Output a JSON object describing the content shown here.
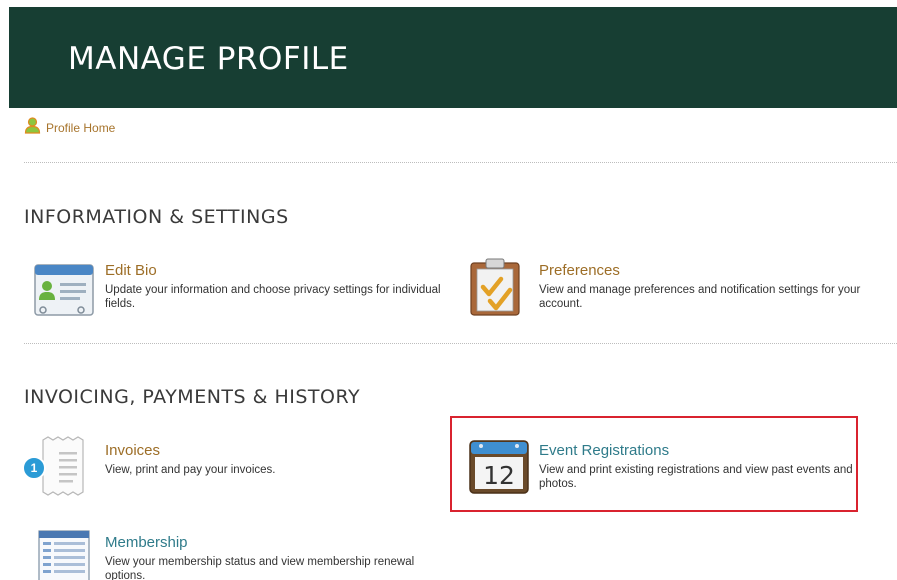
{
  "header": {
    "title": "MANAGE PROFILE"
  },
  "breadcrumb": {
    "label": "Profile Home",
    "icon": "user-icon"
  },
  "sections": [
    {
      "heading": "INFORMATION & SETTINGS",
      "items": [
        {
          "title": "Edit Bio",
          "description": "Update your information and choose privacy settings for individual fields.",
          "icon": "bio-card-icon"
        },
        {
          "title": "Preferences",
          "description": "View and manage preferences and notification settings for your account.",
          "icon": "clipboard-check-icon"
        }
      ]
    },
    {
      "heading": "INVOICING, PAYMENTS & HISTORY",
      "items": [
        {
          "title": "Invoices",
          "description": "View, print and pay your invoices.",
          "icon": "receipt-icon",
          "badge": "1"
        },
        {
          "title": "Event Registrations",
          "description": "View and print existing registrations and view past events and photos.",
          "icon": "calendar-icon",
          "icon_text": "12"
        },
        {
          "title": "Membership",
          "description": "View your membership status and view membership renewal options.",
          "icon": "membership-list-icon"
        }
      ]
    }
  ],
  "colors": {
    "header_bg": "#173e33",
    "link_gold": "#9d6e27",
    "link_teal": "#2f7b8a",
    "highlight_border": "#d9232f",
    "badge_bg": "#2b9bd6"
  }
}
